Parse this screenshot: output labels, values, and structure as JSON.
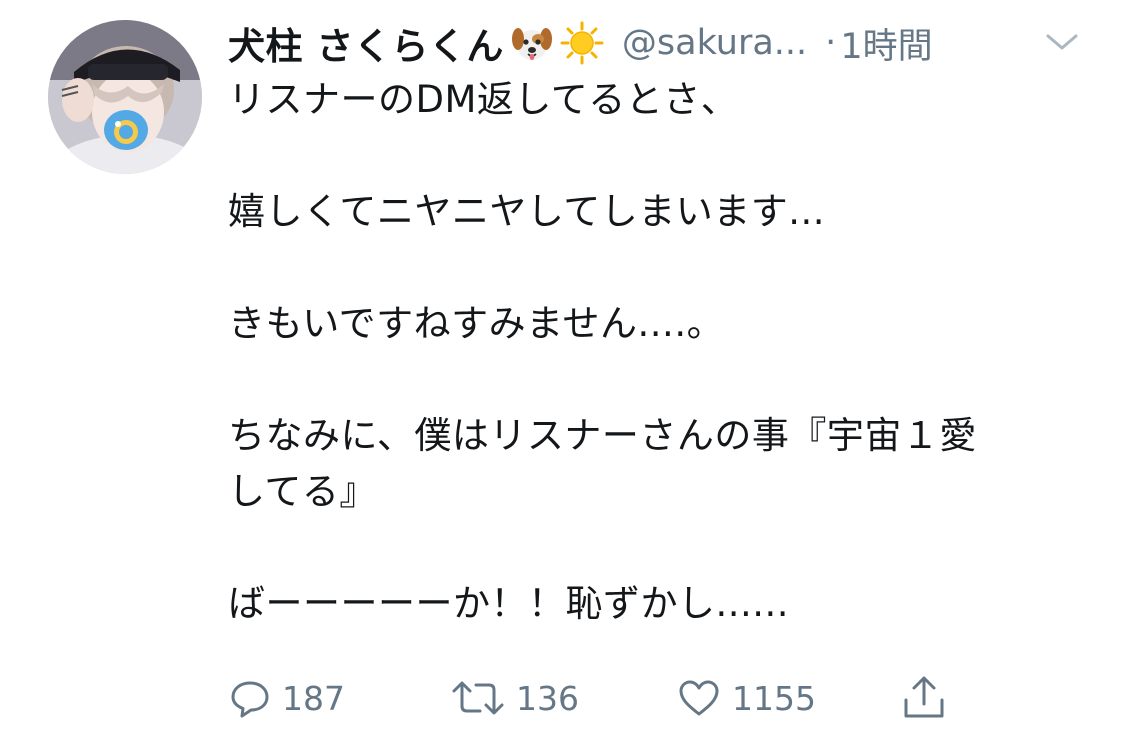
{
  "tweet": {
    "display_name": "犬柱 さくらくん",
    "name_emojis": [
      "dog-face-icon",
      "sun-icon"
    ],
    "handle": "@sakura...",
    "separator": "·",
    "timestamp": "1時間",
    "body_lines": [
      "リスナーのDM返してるとさ、",
      "",
      "嬉しくてニヤニヤしてしまいます...",
      "",
      "きもいですねすみません....。",
      "",
      "ちなみに、僕はリスナーさんの事『宇宙１愛",
      "してる』",
      "",
      "ばーーーーーか！！恥ずかし......"
    ]
  },
  "actions": {
    "reply_count": "187",
    "retweet_count": "136",
    "like_count": "1155"
  },
  "colors": {
    "text": "#14171a",
    "secondary": "#657786",
    "background": "#ffffff"
  }
}
